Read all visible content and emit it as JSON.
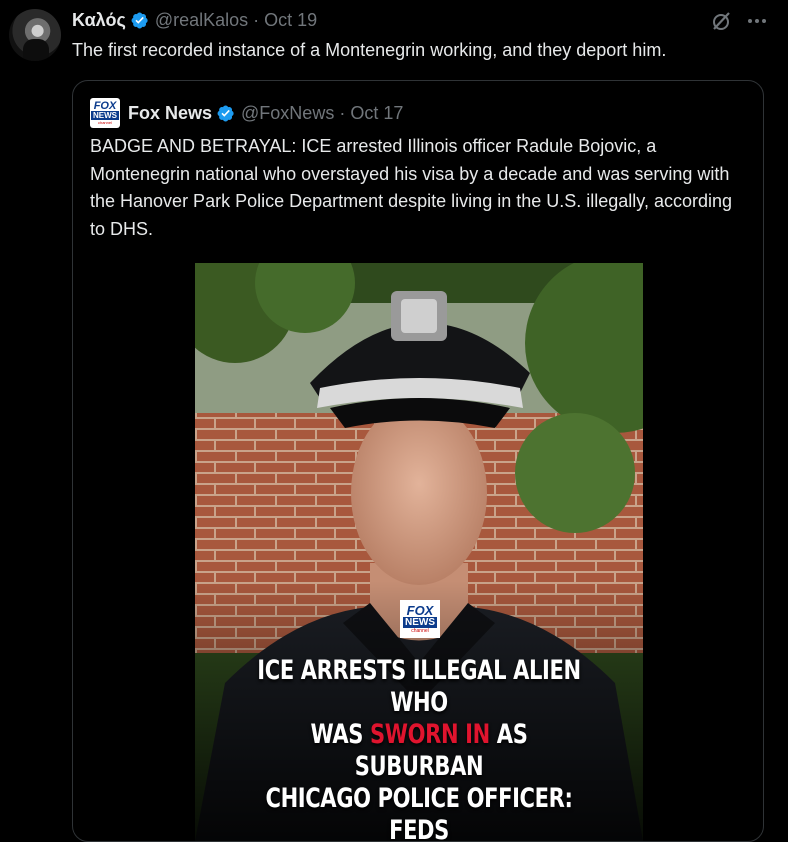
{
  "tweet": {
    "author_name": "Καλός",
    "handle": "@realKalos",
    "separator": "·",
    "date": "Oct 19",
    "text": "The first recorded instance of a Montenegrin working, and they deport him.",
    "more_icon": "more-horizontal-icon",
    "grok_icon": "grok-icon",
    "verified_icon": "verified-badge-icon"
  },
  "quoted_tweet": {
    "logo_text_top": "FOX",
    "logo_text_mid": "NEWS",
    "logo_text_bottom": "channel",
    "author_name": "Fox News",
    "handle": "@FoxNews",
    "separator": "·",
    "date": "Oct 17",
    "text": "BADGE AND BETRAYAL: ICE arrested Illinois officer Radule Bojovic, a Montenegrin national who overstayed his visa by a decade and was serving with the Hanover Park Police Department despite living in the U.S. illegally, according to DHS.",
    "media": {
      "logo_text_top": "FOX",
      "logo_text_mid": "NEWS",
      "logo_text_bottom": "channel",
      "caption_line1": "ICE ARRESTS ILLEGAL ALIEN WHO",
      "caption_line2_pre": "WAS ",
      "caption_line2_highlight": "SWORN IN",
      "caption_line2_post": " AS SUBURBAN",
      "caption_line3": "CHICAGO POLICE OFFICER: FEDS"
    }
  },
  "colors": {
    "background": "#000000",
    "text": "#e7e9ea",
    "muted": "#71767b",
    "verified": "#1d9bf0",
    "border": "#2f3336",
    "caption_highlight": "#e0142e"
  }
}
